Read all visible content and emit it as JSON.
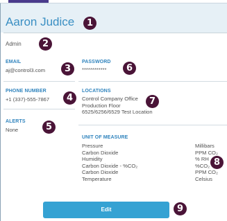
{
  "profile": {
    "name": "Aaron Judice",
    "role": "Admin"
  },
  "email": {
    "label": "EMAIL",
    "value": "aj@control3.com"
  },
  "password": {
    "label": "PASSWORD",
    "value": "************"
  },
  "phone": {
    "label": "PHONE NUMBER",
    "value": "+1 (337)-555-7867"
  },
  "locations": {
    "label": "LOCATIONS",
    "items": [
      "Control Company Office",
      "Production Floor",
      "6525/6256/6529 Test Location"
    ]
  },
  "alerts": {
    "label": "ALERTS",
    "value": "None"
  },
  "unit_of_measure": {
    "label": "UNIT OF MEASURE",
    "rows": [
      {
        "name": "Pressure",
        "unit": "Millibars"
      },
      {
        "name": "Carbon Dioxide",
        "unit": "PPM CO₂"
      },
      {
        "name": "Humidity",
        "unit": "% RH"
      },
      {
        "name": "Carbon Dioxide - %CO₂",
        "unit": "%CO₂"
      },
      {
        "name": "Carbon Dioxide",
        "unit": "PPM CO₂"
      },
      {
        "name": "Temperature",
        "unit": "Celsius"
      }
    ]
  },
  "actions": {
    "edit_label": "Edit"
  },
  "callouts": [
    "1",
    "2",
    "3",
    "4",
    "5",
    "6",
    "7",
    "8",
    "9"
  ],
  "colors": {
    "accent": "#3a8fc3",
    "button": "#35a2d3",
    "callout": "#4a1437"
  }
}
